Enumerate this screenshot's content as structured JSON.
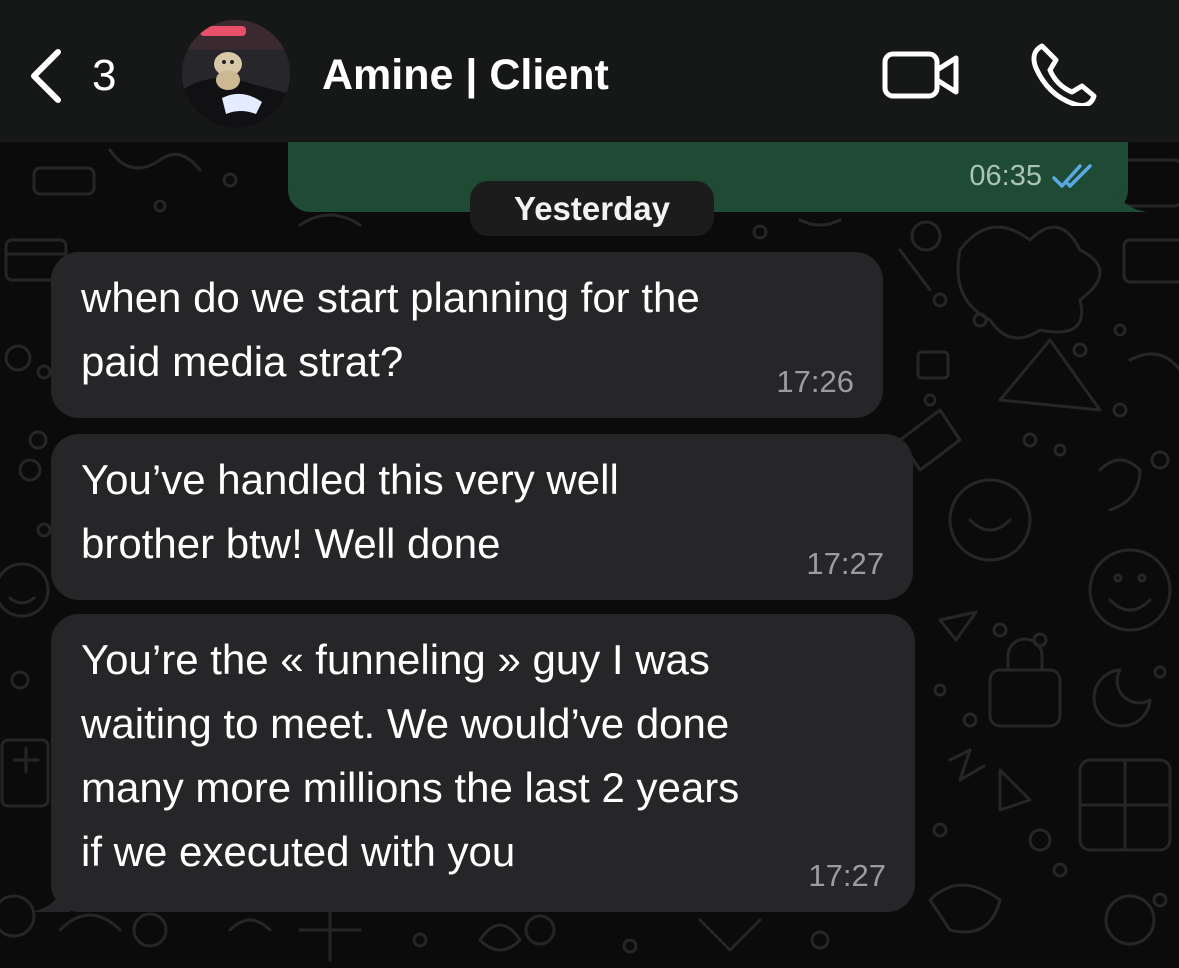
{
  "header": {
    "back_icon": "chevron-left-icon",
    "unread_count": "3",
    "contact_name": "Amine | Client",
    "video_icon": "video-camera-icon",
    "call_icon": "phone-icon"
  },
  "outgoing_message": {
    "time": "06:35",
    "status_icon": "double-check-read-icon",
    "status_color": "#5aa9e6"
  },
  "date_divider": "Yesterday",
  "messages": [
    {
      "lines": [
        "when do we start planning for the",
        "paid media strat?"
      ],
      "time": "17:26"
    },
    {
      "lines": [
        "You’ve handled this very well",
        "brother btw! Well done"
      ],
      "time": "17:27"
    },
    {
      "lines": [
        "You’re the « funneling » guy I was",
        "waiting to meet. We would’ve done",
        "many more millions the last 2 years",
        "if we executed with you"
      ],
      "time": "17:27"
    }
  ],
  "colors": {
    "background": "#0b0b0b",
    "header": "#161817",
    "incoming_bubble": "#262628",
    "outgoing_bubble": "#1f4a33",
    "read_receipt": "#5aa9e6"
  }
}
